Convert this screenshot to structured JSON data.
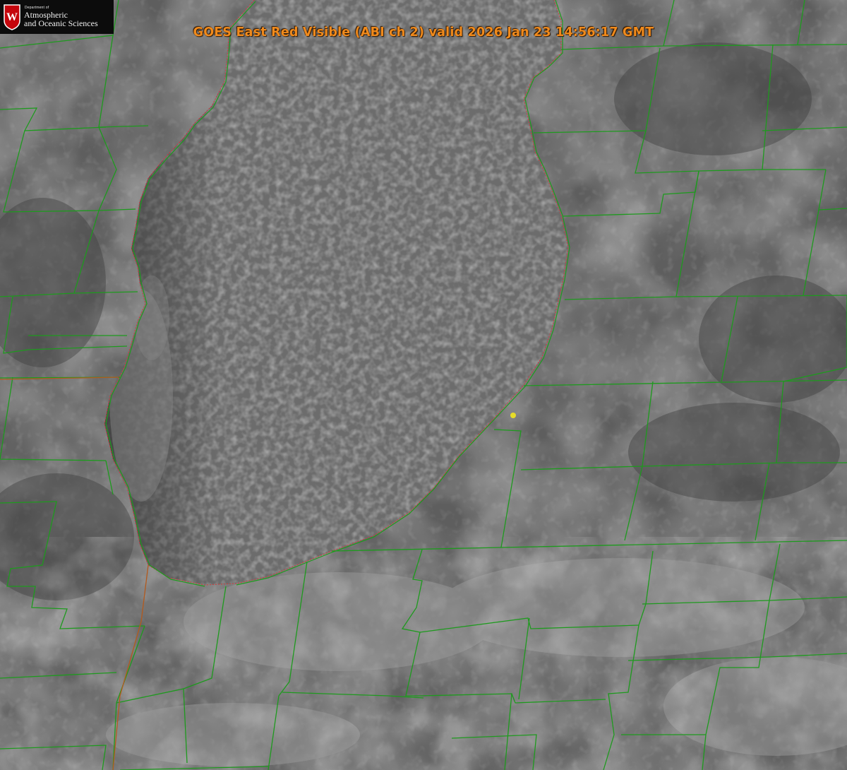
{
  "title": "GOES East Red Visible (ABI ch 2) valid 2026 Jan 23 14:56:17 GMT",
  "logo": {
    "small_text": "Department of",
    "line1": "Atmospheric",
    "line2": "and Oceanic Sciences",
    "shield_letter": "W"
  },
  "colors": {
    "title": "#f08a1c",
    "county_lines": "#1e9a1e",
    "state_line": "#b35a1e",
    "shoreline_dotted": "#d23a3a",
    "marker": "#e6dc28",
    "logo_red": "#c5050c"
  }
}
